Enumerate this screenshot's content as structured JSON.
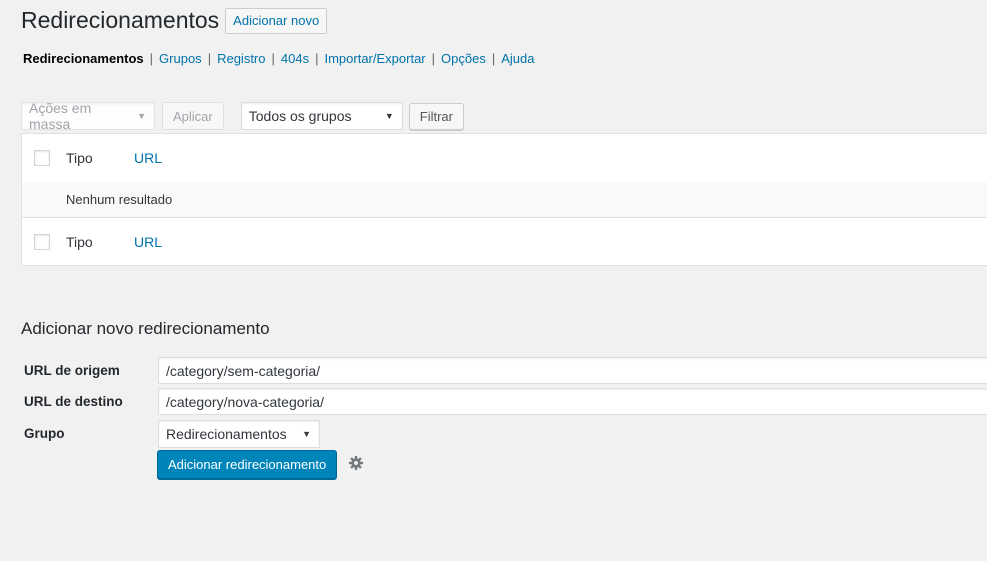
{
  "header": {
    "title": "Redirecionamentos",
    "add_new_label": "Adicionar novo"
  },
  "subnav": {
    "items": [
      {
        "label": "Redirecionamentos",
        "current": true
      },
      {
        "label": "Grupos"
      },
      {
        "label": "Registro"
      },
      {
        "label": "404s"
      },
      {
        "label": "Importar/Exportar"
      },
      {
        "label": "Opções"
      },
      {
        "label": "Ajuda"
      }
    ],
    "separator": "|"
  },
  "tablenav": {
    "bulk_actions": "Ações em massa",
    "apply_label": "Aplicar",
    "group_filter": "Todos os grupos",
    "filter_label": "Filtrar"
  },
  "table": {
    "columns": {
      "type": "Tipo",
      "url": "URL"
    },
    "empty_message": "Nenhum resultado"
  },
  "add_form": {
    "title": "Adicionar novo redirecionamento",
    "source_label": "URL de origem",
    "source_value": "/category/sem-categoria/",
    "target_label": "URL de destino",
    "target_value": "/category/nova-categoria/",
    "group_label": "Grupo",
    "group_value": "Redirecionamentos",
    "submit_label": "Adicionar redirecionamento",
    "options_icon": "gear-icon"
  },
  "colors": {
    "link": "#0073aa",
    "primary": "#0085ba",
    "background": "#f1f1f1"
  }
}
